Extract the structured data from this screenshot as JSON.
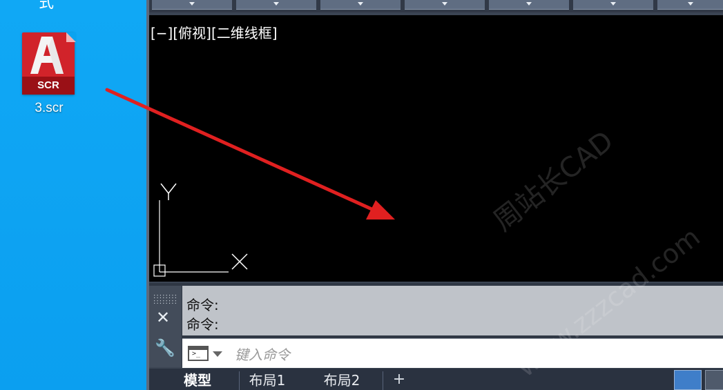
{
  "desktop": {
    "top_partial_char": "式",
    "file": {
      "badge": "SCR",
      "name": "3.scr",
      "icon": "autocad-script-file-icon"
    }
  },
  "cad": {
    "toolbar_buttons": [
      "",
      "",
      "",
      "",
      "",
      "",
      ""
    ],
    "viewport": {
      "label": "[−][俯视][二维线框]",
      "ucs_x": "X",
      "ucs_y": "Y"
    },
    "command": {
      "history": [
        "命令:",
        "命令:"
      ],
      "placeholder": "键入命令",
      "grip_icon": "grip-dots-icon",
      "close_icon": "close-icon",
      "customize_icon": "wrench-icon"
    },
    "tabs": [
      {
        "label": "模型",
        "active": true
      },
      {
        "label": "布局1",
        "active": false
      },
      {
        "label": "布局2",
        "active": false
      }
    ],
    "add_tab_label": "+"
  },
  "watermark": {
    "line1": "周站长CAD",
    "line2": "www.zzzcad.com"
  },
  "colors": {
    "desktop": "#0aa3f0",
    "viewport": "#000000",
    "arrow": "#e02020"
  }
}
